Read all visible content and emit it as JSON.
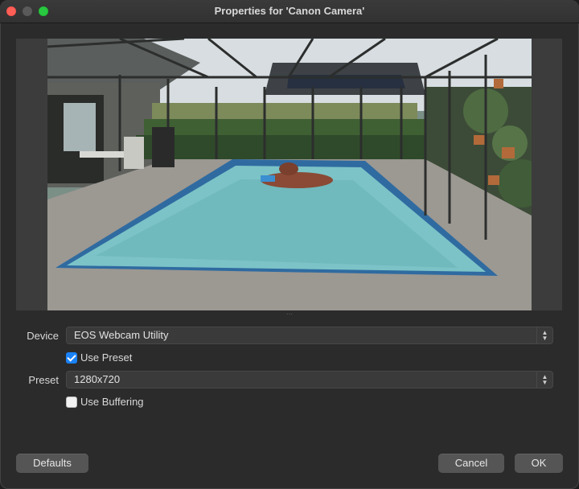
{
  "window": {
    "title": "Properties for 'Canon Camera'"
  },
  "form": {
    "device": {
      "label": "Device",
      "value": "EOS Webcam Utility"
    },
    "use_preset": {
      "label": "Use Preset",
      "checked": true
    },
    "preset": {
      "label": "Preset",
      "value": "1280x720"
    },
    "use_buffering": {
      "label": "Use Buffering",
      "checked": false
    }
  },
  "buttons": {
    "defaults": "Defaults",
    "cancel": "Cancel",
    "ok": "OK"
  },
  "icons": {
    "combo_arrows": "chevron-up-down-icon",
    "check": "checkmark-icon"
  },
  "colors": {
    "accent": "#1a82f7",
    "close": "#ff5f57",
    "zoom": "#28c840",
    "background": "#2b2b2b"
  }
}
